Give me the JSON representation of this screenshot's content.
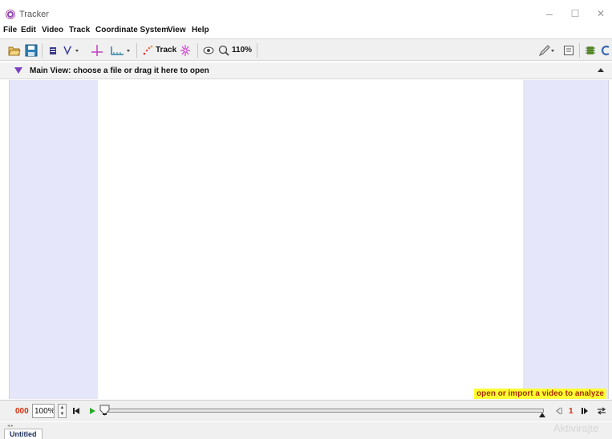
{
  "window": {
    "title": "Tracker",
    "minimize_glyph": "–",
    "maximize_glyph": "☐",
    "close_glyph": "✕"
  },
  "menu": [
    "File",
    "Edit",
    "Video",
    "Track",
    "Coordinate System",
    "View",
    "Help"
  ],
  "toolbar": {
    "track_label": "Track",
    "zoom_label": "110%",
    "icons": [
      "open-folder-icon",
      "save-icon",
      "clip-settings-icon",
      "calibration-icon",
      "axes-icon",
      "tape-measure-icon",
      "track-points-icon",
      "autotracker-icon",
      "visibility-eye-icon",
      "zoom-icon",
      "pencil-icon",
      "notes-icon",
      "memory-icon",
      "refresh-icon"
    ]
  },
  "main_view": {
    "title": "Main View: choose a file or drag it here to open",
    "status_message": "open or import a video to analyze"
  },
  "player": {
    "frame_number": "000",
    "rate": "100%",
    "step_size": "1",
    "slider_value": 0
  },
  "tabs": [
    "Untitled"
  ],
  "watermark": "Aktivirajte",
  "colors": {
    "accent_purple": "#7d3fc0",
    "frame_red": "#d03010",
    "status_yellow": "#ffff33",
    "canvas_lavender": "#e6e6fa"
  }
}
